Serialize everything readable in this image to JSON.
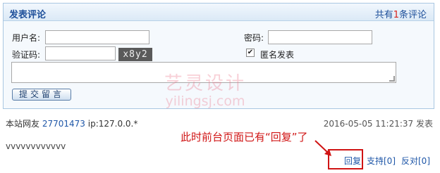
{
  "panel": {
    "title": "发表评论",
    "count_prefix": "共有",
    "count": "1",
    "count_suffix": "条评论"
  },
  "form": {
    "username_label": "用户名:",
    "username_value": "",
    "password_label": "密码:",
    "password_value": "",
    "captcha_label": "验证码:",
    "captcha_value": "",
    "captcha_image_text": "x8y2",
    "anonymous_label": "匿名发表",
    "anonymous_checked": "✔",
    "comment_value": "",
    "submit_label": "提交留言"
  },
  "watermark": {
    "cn": "艺灵设计",
    "en": "yilingsj.com"
  },
  "comment": {
    "author_prefix": "本站网友",
    "author_id": "27701473",
    "ip": "ip:127.0.0.*",
    "time": "2016-05-05 11:21:37 发表",
    "body": "vvvvvvvvvvvv",
    "actions": {
      "reply": "回复",
      "support": "支持[0]",
      "oppose": "反对[0]"
    }
  },
  "annotation": {
    "text": "此时前台页面已有“回复”了",
    "color": "#d01414"
  },
  "colors": {
    "link": "#1f57a8",
    "panel_title": "#1d4f9a",
    "count_number": "#d9231d"
  }
}
